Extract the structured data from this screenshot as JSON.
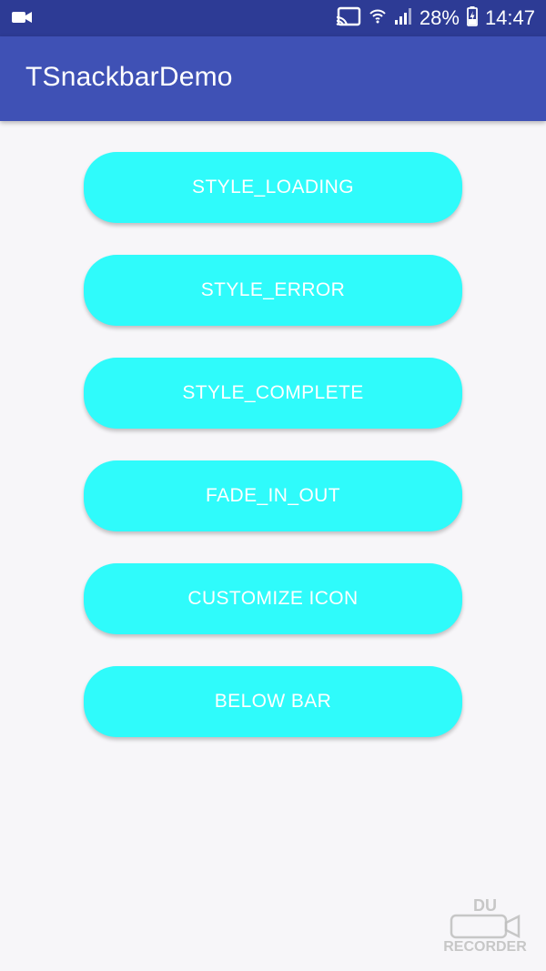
{
  "status_bar": {
    "battery": "28%",
    "time": "14:47",
    "icons": [
      "video-recording-icon",
      "cast-icon",
      "wifi-icon",
      "signal-icon",
      "battery-charging-icon"
    ]
  },
  "app_bar": {
    "title": "TSnackbarDemo"
  },
  "buttons": [
    {
      "label": "STYLE_LOADING"
    },
    {
      "label": "STYLE_ERROR"
    },
    {
      "label": "STYLE_COMPLETE"
    },
    {
      "label": "FADE_IN_OUT"
    },
    {
      "label": "CUSTOMIZE ICON"
    },
    {
      "label": "BELOW BAR"
    }
  ],
  "watermark": {
    "top": "DU",
    "bottom": "RECORDER"
  },
  "colors": {
    "status_bar": "#2d3b95",
    "app_bar": "#3f51b5",
    "button": "#2ffbfb",
    "background": "#f7f6f9"
  }
}
